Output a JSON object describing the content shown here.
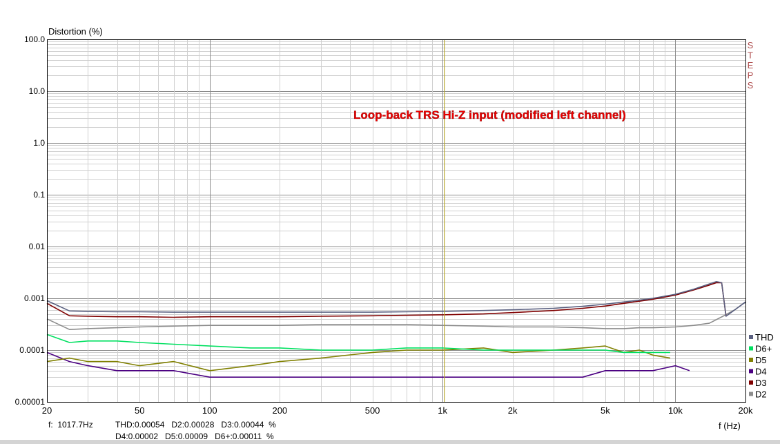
{
  "chart_data": {
    "type": "line",
    "title": "",
    "ylabel": "Distortion (%)",
    "xlabel": "f (Hz)",
    "annotation": "Loop-back TRS Hi-Z input (modified left channel)",
    "side_label": "STEPS",
    "x_scale": "log",
    "y_scale": "log",
    "xlim": [
      20,
      20000
    ],
    "ylim": [
      1e-05,
      100
    ],
    "grid": true,
    "legend_position": "bottom-right",
    "marker_frequency_hz": 1017.7,
    "x_ticks": [
      {
        "value": 20,
        "label": "20"
      },
      {
        "value": 50,
        "label": "50"
      },
      {
        "value": 100,
        "label": "100"
      },
      {
        "value": 200,
        "label": "200"
      },
      {
        "value": 500,
        "label": "500"
      },
      {
        "value": 1000,
        "label": "1k"
      },
      {
        "value": 2000,
        "label": "2k"
      },
      {
        "value": 5000,
        "label": "5k"
      },
      {
        "value": 10000,
        "label": "10k"
      },
      {
        "value": 20000,
        "label": "20k"
      }
    ],
    "y_ticks": [
      {
        "value": 100,
        "label": "100.0"
      },
      {
        "value": 10,
        "label": "10.0"
      },
      {
        "value": 1,
        "label": "1.0"
      },
      {
        "value": 0.1,
        "label": "0.1"
      },
      {
        "value": 0.01,
        "label": "0.01"
      },
      {
        "value": 0.001,
        "label": "0.001"
      },
      {
        "value": 0.0001,
        "label": "0.0001"
      },
      {
        "value": 1e-05,
        "label": "0.00001"
      }
    ],
    "series": [
      {
        "name": "THD",
        "color": "#5a6080",
        "x": [
          20,
          25,
          30,
          40,
          50,
          70,
          100,
          150,
          200,
          300,
          500,
          700,
          1000,
          1500,
          2000,
          3000,
          4000,
          5000,
          6000,
          7000,
          8000,
          10000,
          12000,
          14000,
          15000,
          15800,
          16500,
          20000
        ],
        "y": [
          0.0009,
          0.00057,
          0.00056,
          0.00055,
          0.00055,
          0.00054,
          0.00054,
          0.00054,
          0.00054,
          0.00054,
          0.00054,
          0.00055,
          0.00056,
          0.00058,
          0.0006,
          0.00064,
          0.0007,
          0.00077,
          0.00085,
          0.00092,
          0.001,
          0.0012,
          0.0015,
          0.0019,
          0.0021,
          0.002,
          0.00045,
          0.00085
        ]
      },
      {
        "name": "D3",
        "color": "#800000",
        "x": [
          20,
          25,
          30,
          40,
          50,
          70,
          100,
          150,
          200,
          300,
          500,
          700,
          1000,
          1500,
          2000,
          3000,
          4000,
          5000,
          6000,
          7000,
          8000,
          10000,
          12000,
          14000,
          15000,
          15800,
          16500
        ],
        "y": [
          0.0008,
          0.00046,
          0.00045,
          0.00044,
          0.00044,
          0.00043,
          0.00044,
          0.00044,
          0.00044,
          0.00045,
          0.00046,
          0.00047,
          0.00048,
          0.0005,
          0.00053,
          0.00058,
          0.00064,
          0.00071,
          0.0008,
          0.00088,
          0.00096,
          0.00115,
          0.00145,
          0.0018,
          0.002,
          0.002,
          0.00045
        ]
      },
      {
        "name": "D2",
        "color": "#8c8c8c",
        "x": [
          20,
          25,
          30,
          40,
          50,
          70,
          100,
          150,
          200,
          300,
          500,
          700,
          1000,
          1500,
          2000,
          3000,
          4000,
          5000,
          6000,
          7000,
          8000,
          10000,
          12000,
          14000,
          16000,
          18000,
          20000
        ],
        "y": [
          0.0004,
          0.00025,
          0.00026,
          0.00027,
          0.00028,
          0.00029,
          0.0003,
          0.0003,
          0.0003,
          0.00031,
          0.00031,
          0.00031,
          0.0003,
          0.00029,
          0.00028,
          0.00028,
          0.00027,
          0.00026,
          0.00026,
          0.00027,
          0.00027,
          0.00028,
          0.0003,
          0.00033,
          0.00045,
          0.0006,
          0.00085
        ]
      },
      {
        "name": "D6+",
        "color": "#00e060",
        "x": [
          20,
          25,
          30,
          40,
          50,
          70,
          100,
          150,
          200,
          300,
          500,
          700,
          1000,
          1500,
          2000,
          3000,
          4000,
          5000,
          6000,
          7000,
          8000,
          9500
        ],
        "y": [
          0.0002,
          0.00014,
          0.00015,
          0.00015,
          0.00014,
          0.00013,
          0.00012,
          0.00011,
          0.00011,
          0.0001,
          0.0001,
          0.00011,
          0.00011,
          0.0001,
          0.0001,
          0.0001,
          0.0001,
          0.0001,
          9e-05,
          9e-05,
          9e-05,
          9e-05
        ]
      },
      {
        "name": "D5",
        "color": "#808000",
        "x": [
          20,
          25,
          30,
          40,
          50,
          70,
          100,
          150,
          200,
          300,
          500,
          700,
          1000,
          1500,
          2000,
          3000,
          4000,
          5000,
          6000,
          7000,
          8000,
          9500
        ],
        "y": [
          6e-05,
          7e-05,
          6e-05,
          6e-05,
          5e-05,
          6e-05,
          4e-05,
          5e-05,
          6e-05,
          7e-05,
          9e-05,
          0.0001,
          0.0001,
          0.00011,
          9e-05,
          0.0001,
          0.00011,
          0.00012,
          9e-05,
          0.0001,
          8e-05,
          7e-05
        ]
      },
      {
        "name": "D4",
        "color": "#4b0082",
        "x": [
          20,
          25,
          30,
          40,
          50,
          70,
          100,
          150,
          200,
          300,
          500,
          700,
          1000,
          1500,
          2000,
          3000,
          4000,
          5000,
          6000,
          7000,
          8000,
          10000,
          11500
        ],
        "y": [
          9e-05,
          6e-05,
          5e-05,
          4e-05,
          4e-05,
          4e-05,
          3e-05,
          3e-05,
          3e-05,
          3e-05,
          3e-05,
          3e-05,
          3e-05,
          3e-05,
          3e-05,
          3e-05,
          3e-05,
          4e-05,
          4e-05,
          4e-05,
          4e-05,
          5e-05,
          4e-05
        ]
      }
    ]
  },
  "status": {
    "freq": "f:  1017.7Hz",
    "line1": "THD:0.00054   D2:0.00028   D3:0.00044  %",
    "line2": "D4:0.00002   D5:0.00009   D6+:0.00011  %"
  }
}
